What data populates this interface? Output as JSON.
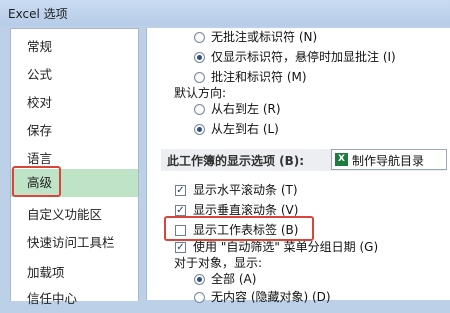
{
  "window": {
    "title": "Excel 选项"
  },
  "sidebar": {
    "items": [
      {
        "label": "常规"
      },
      {
        "label": "公式"
      },
      {
        "label": "校对"
      },
      {
        "label": "保存"
      },
      {
        "label": "语言"
      },
      {
        "label": "高级"
      },
      {
        "label": "自定义功能区"
      },
      {
        "label": "快速访问工具栏"
      },
      {
        "label": "加载项"
      },
      {
        "label": "信任中心"
      }
    ],
    "selected": "高级"
  },
  "main": {
    "comment_options": [
      {
        "label": "无批注或标识符 (N)",
        "selected": false
      },
      {
        "label": "仅显示标识符，悬停时加显批注 (I)",
        "selected": true
      },
      {
        "label": "批注和标识符 (M)",
        "selected": false
      }
    ],
    "default_direction": {
      "label": "默认方向:",
      "options": [
        {
          "label": "从右到左 (R)",
          "selected": false
        },
        {
          "label": "从左到右 (L)",
          "selected": true
        }
      ]
    },
    "workbook_section": {
      "label": "此工作簿的显示选项 (B):",
      "workbook_name": "制作导航目录",
      "workbook_icon": "X"
    },
    "workbook_checks": [
      {
        "label": "显示水平滚动条 (T)",
        "checked": true
      },
      {
        "label": "显示垂直滚动条 (V)",
        "checked": true
      },
      {
        "label": "显示工作表标签 (B)",
        "checked": false
      },
      {
        "label": "使用 \"自动筛选\" 菜单分组日期 (G)",
        "checked": true
      }
    ],
    "objects": {
      "label": "对于对象，显示:",
      "options": [
        {
          "label": "全部 (A)",
          "selected": true
        },
        {
          "label": "无内容 (隐藏对象) (D)",
          "selected": false
        }
      ]
    }
  },
  "colors": {
    "highlight": "#d9453b",
    "selected_item": "#bfe3c6"
  }
}
